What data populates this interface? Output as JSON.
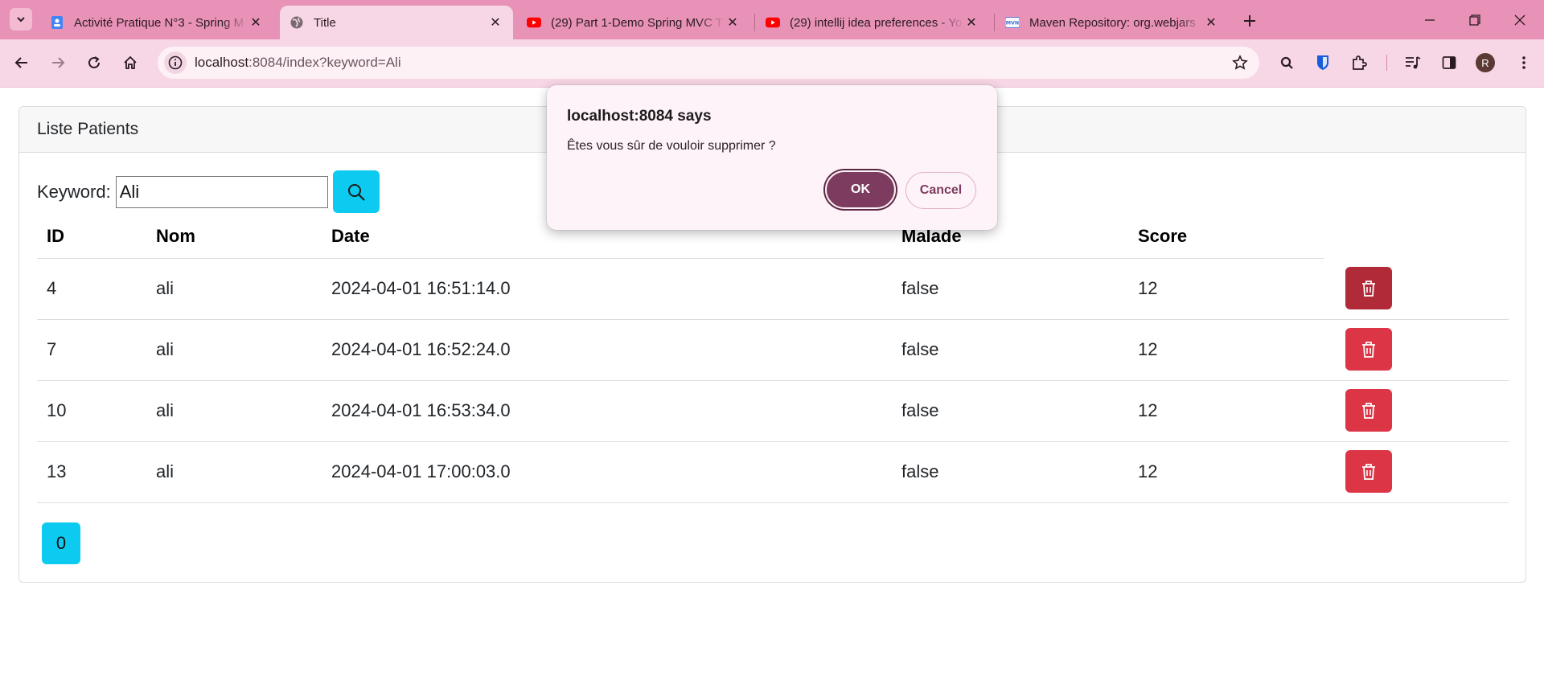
{
  "browser": {
    "tabs": [
      {
        "title": "Activité Pratique N°3 - Spring M",
        "icon": "google-drive-doc-icon",
        "active": false
      },
      {
        "title": "Title",
        "icon": "globe-icon",
        "active": true
      },
      {
        "title": "(29) Part 1-Demo Spring MVC T",
        "icon": "youtube-icon",
        "active": false
      },
      {
        "title": "(29) intellij idea preferences - Yo",
        "icon": "youtube-icon",
        "active": false
      },
      {
        "title": "Maven Repository: org.webjars",
        "icon": "mvn-icon",
        "active": false
      }
    ],
    "address": {
      "host": "localhost",
      "rest": ":8084/index?keyword=Ali"
    },
    "profile_initial": "R"
  },
  "page": {
    "card_title": "Liste Patients",
    "keyword_label": "Keyword:",
    "keyword_value": "Ali",
    "table": {
      "headers": [
        "ID",
        "Nom",
        "Date",
        "Malade",
        "Score"
      ],
      "rows": [
        {
          "id": "4",
          "nom": "ali",
          "date": "2024-04-01 16:51:14.0",
          "malade": "false",
          "score": "12"
        },
        {
          "id": "7",
          "nom": "ali",
          "date": "2024-04-01 16:52:24.0",
          "malade": "false",
          "score": "12"
        },
        {
          "id": "10",
          "nom": "ali",
          "date": "2024-04-01 16:53:34.0",
          "malade": "false",
          "score": "12"
        },
        {
          "id": "13",
          "nom": "ali",
          "date": "2024-04-01 17:00:03.0",
          "malade": "false",
          "score": "12"
        }
      ]
    },
    "pagination": [
      "0"
    ]
  },
  "dialog": {
    "title": "localhost:8084 says",
    "message": "Êtes vous sûr de vouloir supprimer ?",
    "ok_label": "OK",
    "cancel_label": "Cancel"
  },
  "colors": {
    "tabstrip": "#e992b8",
    "toolbar": "#f7d6e5",
    "info_button": "#0dcaf0",
    "danger_button": "#dc3545",
    "dialog_ok": "#7d3c5f"
  }
}
